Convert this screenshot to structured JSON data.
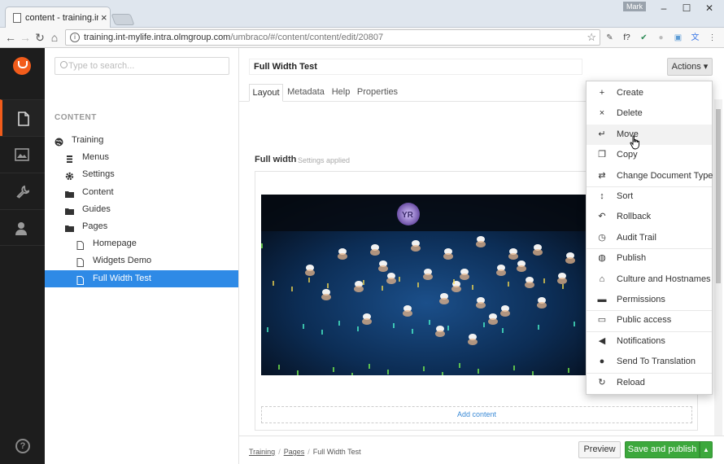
{
  "browser": {
    "tab_title": "content - training.int-myl",
    "tab_close": "×",
    "user_badge": "Mark",
    "window_min": "–",
    "window_max": "☐",
    "window_close": "✕",
    "url_host": "training.int-mylife.intra.olmgroup.com",
    "url_path": "/umbraco/#/content/content/edit/20807",
    "nav_back": "←",
    "nav_forward": "→",
    "nav_reload": "↻",
    "nav_home": "⌂",
    "star": "☆",
    "extensions": [
      {
        "name": "eyedropper-icon",
        "glyph": "✎",
        "color": "#555555"
      },
      {
        "name": "formula-icon",
        "glyph": "f?",
        "color": "#333333"
      },
      {
        "name": "leaf-icon",
        "glyph": "✔",
        "color": "#2e8b57"
      },
      {
        "name": "circle-icon",
        "glyph": "●",
        "color": "#bbbbbb"
      },
      {
        "name": "screenshot-icon",
        "glyph": "▣",
        "color": "#5b9bd5"
      },
      {
        "name": "translate-icon",
        "glyph": "文",
        "color": "#3b78e7"
      },
      {
        "name": "menu-dots-icon",
        "glyph": "⋮",
        "color": "#555555"
      }
    ]
  },
  "sections": {
    "items": [
      {
        "name": "section-content",
        "icon": "document-icon",
        "active": true
      },
      {
        "name": "section-media",
        "icon": "image-icon",
        "active": false
      },
      {
        "name": "section-settings",
        "icon": "wrench-icon",
        "active": false
      },
      {
        "name": "section-users",
        "icon": "user-icon",
        "active": false
      }
    ],
    "help": "?"
  },
  "tree": {
    "search_placeholder": "Type to search...",
    "title": "CONTENT",
    "nodes": [
      {
        "label": "Training",
        "icon": "globe-icon",
        "depth": 0,
        "selected": false
      },
      {
        "label": "Menus",
        "icon": "list-icon",
        "depth": 1,
        "selected": false
      },
      {
        "label": "Settings",
        "icon": "gear-icon",
        "depth": 1,
        "selected": false
      },
      {
        "label": "Content",
        "icon": "folder-icon",
        "depth": 1,
        "selected": false
      },
      {
        "label": "Guides",
        "icon": "folder-icon",
        "depth": 1,
        "selected": false
      },
      {
        "label": "Pages",
        "icon": "folder-icon",
        "depth": 1,
        "selected": false
      },
      {
        "label": "Homepage",
        "icon": "page-icon",
        "depth": 2,
        "selected": false
      },
      {
        "label": "Widgets Demo",
        "icon": "page-icon",
        "depth": 2,
        "selected": false
      },
      {
        "label": "Full Width Test",
        "icon": "page-icon",
        "depth": 2,
        "selected": true
      }
    ]
  },
  "editor": {
    "name_value": "Full Width Test",
    "actions_label": "Actions ▾",
    "tabs": [
      {
        "label": "Layout",
        "active": true
      },
      {
        "label": "Metadata",
        "active": false
      },
      {
        "label": "Help",
        "active": false
      },
      {
        "label": "Properties",
        "active": false
      }
    ],
    "grid_title": "Full width",
    "grid_subtitle": "Settings applied",
    "add_content": "Add content",
    "breadcrumb": [
      "Training",
      "Pages",
      "Full Width Test"
    ],
    "preview_label": "Preview",
    "save_label": "Save and publish",
    "save_caret": "▲"
  },
  "actions_menu": {
    "items": [
      {
        "label": "Create",
        "icon": "plus-icon",
        "glyph": "+",
        "hover": false
      },
      {
        "label": "Delete",
        "icon": "close-icon",
        "glyph": "×",
        "hover": false
      },
      {
        "label": "Move",
        "icon": "move-icon",
        "glyph": "↵",
        "hover": true
      },
      {
        "label": "Copy",
        "icon": "copy-icon",
        "glyph": "❐",
        "hover": false
      },
      {
        "label": "Change Document Type",
        "icon": "exchange-icon",
        "glyph": "⇄",
        "hover": false
      },
      {
        "label": "Sort",
        "icon": "sort-icon",
        "glyph": "↕",
        "hover": false
      },
      {
        "label": "Rollback",
        "icon": "undo-icon",
        "glyph": "↶",
        "hover": false
      },
      {
        "label": "Audit Trail",
        "icon": "clock-icon",
        "glyph": "◷",
        "hover": false
      },
      {
        "label": "Publish",
        "icon": "globe-icon",
        "glyph": "◍",
        "hover": false
      },
      {
        "label": "Culture and Hostnames",
        "icon": "home-icon",
        "glyph": "⌂",
        "hover": false
      },
      {
        "label": "Permissions",
        "icon": "lock-icon",
        "glyph": "▬",
        "hover": false
      },
      {
        "label": "Public access",
        "icon": "keyhole-icon",
        "glyph": "▭",
        "hover": false
      },
      {
        "label": "Notifications",
        "icon": "megaphone-icon",
        "glyph": "◀",
        "hover": false
      },
      {
        "label": "Send To Translation",
        "icon": "speech-bubble-icon",
        "glyph": "●",
        "hover": false
      },
      {
        "label": "Reload",
        "icon": "refresh-icon",
        "glyph": "↻",
        "hover": false
      }
    ]
  },
  "colors": {
    "brand": "#f25c1b",
    "selected": "#2e8ae6",
    "save": "#3ca83c",
    "sidebar": "#1d1d1d"
  }
}
